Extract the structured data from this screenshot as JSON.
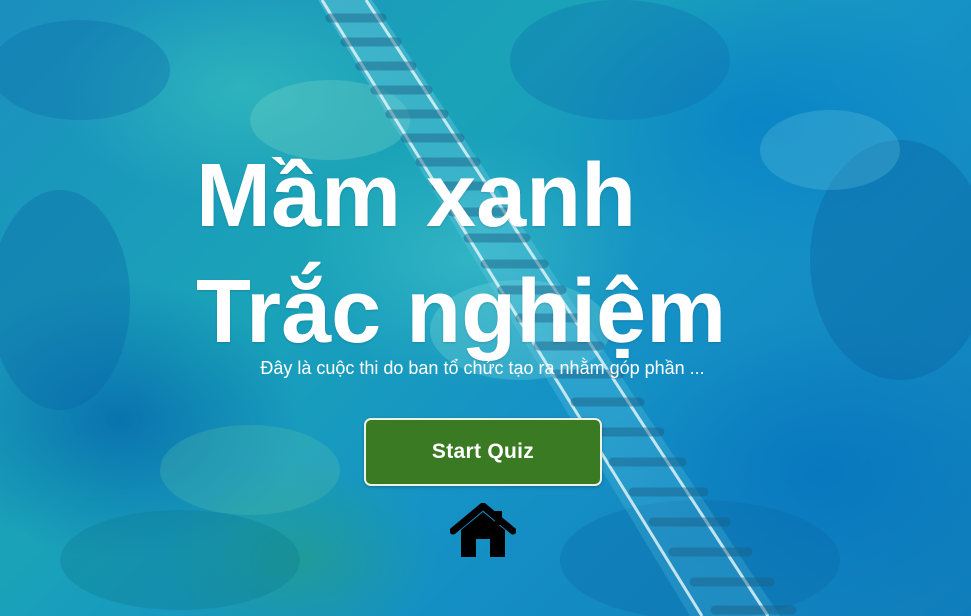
{
  "hero": {
    "title_line1": "Mầm xanh",
    "title_line2": "Trắc nghiệm",
    "description": "Đây là cuộc thi do ban tổ chức tạo ra nhằm góp phần ..."
  },
  "actions": {
    "start_label": "Start Quiz",
    "home_icon": "home-icon"
  },
  "colors": {
    "button_bg": "#3a7a23",
    "button_border": "#e9f2e4",
    "title": "#ffffff",
    "icon": "#000000"
  }
}
